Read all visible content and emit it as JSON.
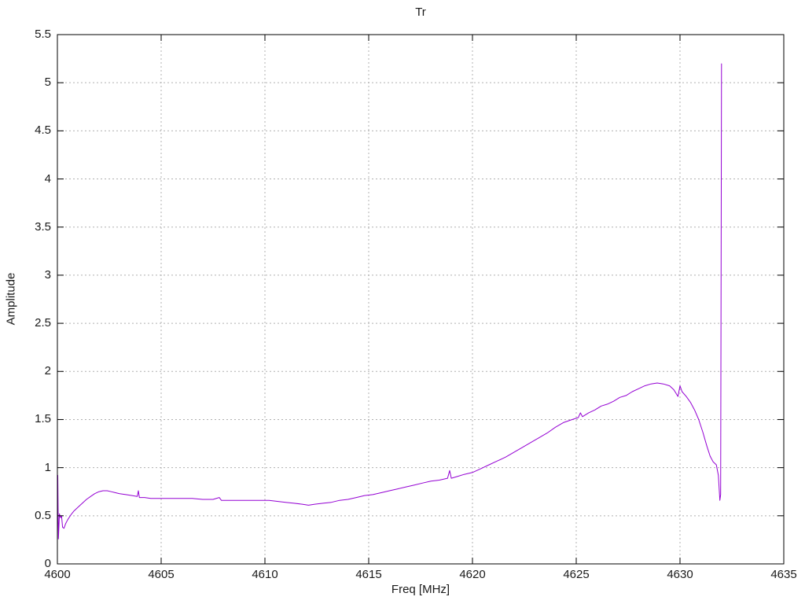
{
  "title": "Tr",
  "colors": {
    "line": "#9400d3",
    "grid": "#b0b0b0",
    "axis": "#000000",
    "text": "#1a1a1a",
    "background": "#ffffff"
  },
  "chart_data": {
    "type": "line",
    "title": "Tr",
    "xlabel": "Freq [MHz]",
    "ylabel": "Amplitude",
    "xlim": [
      4600,
      4635
    ],
    "ylim": [
      0,
      5.5
    ],
    "x_ticks": [
      4600,
      4605,
      4610,
      4615,
      4620,
      4625,
      4630,
      4635
    ],
    "y_ticks": [
      0,
      0.5,
      1,
      1.5,
      2,
      2.5,
      3,
      3.5,
      4,
      4.5,
      5,
      5.5
    ],
    "grid": true,
    "legend_position": "none",
    "series": [
      {
        "name": "Tr",
        "color": "#9400d3",
        "points": [
          [
            4600.0,
            0.3
          ],
          [
            4600.02,
            0.92
          ],
          [
            4600.05,
            0.26
          ],
          [
            4600.1,
            0.52
          ],
          [
            4600.15,
            0.48
          ],
          [
            4600.2,
            0.5
          ],
          [
            4600.25,
            0.38
          ],
          [
            4600.32,
            0.37
          ],
          [
            4600.4,
            0.42
          ],
          [
            4600.5,
            0.46
          ],
          [
            4600.65,
            0.51
          ],
          [
            4600.8,
            0.55
          ],
          [
            4601.0,
            0.59
          ],
          [
            4601.2,
            0.63
          ],
          [
            4601.4,
            0.67
          ],
          [
            4601.6,
            0.7
          ],
          [
            4601.8,
            0.73
          ],
          [
            4602.0,
            0.75
          ],
          [
            4602.2,
            0.76
          ],
          [
            4602.4,
            0.76
          ],
          [
            4602.6,
            0.75
          ],
          [
            4602.8,
            0.74
          ],
          [
            4603.0,
            0.73
          ],
          [
            4603.3,
            0.72
          ],
          [
            4603.6,
            0.71
          ],
          [
            4603.85,
            0.7
          ],
          [
            4603.9,
            0.76
          ],
          [
            4603.95,
            0.69
          ],
          [
            4604.2,
            0.69
          ],
          [
            4604.5,
            0.68
          ],
          [
            4605.0,
            0.68
          ],
          [
            4605.5,
            0.68
          ],
          [
            4606.0,
            0.68
          ],
          [
            4606.5,
            0.68
          ],
          [
            4607.0,
            0.67
          ],
          [
            4607.5,
            0.67
          ],
          [
            4607.8,
            0.69
          ],
          [
            4607.9,
            0.66
          ],
          [
            4608.2,
            0.66
          ],
          [
            4608.6,
            0.66
          ],
          [
            4609.0,
            0.66
          ],
          [
            4609.4,
            0.66
          ],
          [
            4609.8,
            0.66
          ],
          [
            4610.2,
            0.66
          ],
          [
            4610.6,
            0.65
          ],
          [
            4611.0,
            0.64
          ],
          [
            4611.4,
            0.63
          ],
          [
            4611.8,
            0.62
          ],
          [
            4612.1,
            0.61
          ],
          [
            4612.4,
            0.62
          ],
          [
            4612.8,
            0.63
          ],
          [
            4613.2,
            0.64
          ],
          [
            4613.6,
            0.66
          ],
          [
            4614.0,
            0.67
          ],
          [
            4614.4,
            0.69
          ],
          [
            4614.8,
            0.71
          ],
          [
            4615.2,
            0.72
          ],
          [
            4615.6,
            0.74
          ],
          [
            4616.0,
            0.76
          ],
          [
            4616.4,
            0.78
          ],
          [
            4616.8,
            0.8
          ],
          [
            4617.2,
            0.82
          ],
          [
            4617.6,
            0.84
          ],
          [
            4618.0,
            0.86
          ],
          [
            4618.4,
            0.87
          ],
          [
            4618.8,
            0.89
          ],
          [
            4618.9,
            0.97
          ],
          [
            4618.98,
            0.89
          ],
          [
            4619.3,
            0.91
          ],
          [
            4619.6,
            0.93
          ],
          [
            4620.0,
            0.95
          ],
          [
            4620.4,
            0.99
          ],
          [
            4620.8,
            1.03
          ],
          [
            4621.2,
            1.07
          ],
          [
            4621.6,
            1.11
          ],
          [
            4622.0,
            1.16
          ],
          [
            4622.4,
            1.21
          ],
          [
            4622.8,
            1.26
          ],
          [
            4623.2,
            1.31
          ],
          [
            4623.6,
            1.36
          ],
          [
            4624.0,
            1.42
          ],
          [
            4624.4,
            1.47
          ],
          [
            4624.8,
            1.5
          ],
          [
            4625.1,
            1.52
          ],
          [
            4625.2,
            1.57
          ],
          [
            4625.3,
            1.53
          ],
          [
            4625.6,
            1.57
          ],
          [
            4625.9,
            1.6
          ],
          [
            4626.2,
            1.64
          ],
          [
            4626.5,
            1.66
          ],
          [
            4626.8,
            1.69
          ],
          [
            4627.1,
            1.73
          ],
          [
            4627.4,
            1.75
          ],
          [
            4627.7,
            1.79
          ],
          [
            4628.0,
            1.82
          ],
          [
            4628.3,
            1.85
          ],
          [
            4628.6,
            1.87
          ],
          [
            4628.9,
            1.88
          ],
          [
            4629.2,
            1.87
          ],
          [
            4629.5,
            1.85
          ],
          [
            4629.7,
            1.81
          ],
          [
            4629.9,
            1.74
          ],
          [
            4630.0,
            1.85
          ],
          [
            4630.1,
            1.79
          ],
          [
            4630.3,
            1.74
          ],
          [
            4630.5,
            1.68
          ],
          [
            4630.7,
            1.6
          ],
          [
            4630.9,
            1.5
          ],
          [
            4631.1,
            1.37
          ],
          [
            4631.3,
            1.22
          ],
          [
            4631.45,
            1.12
          ],
          [
            4631.6,
            1.06
          ],
          [
            4631.75,
            1.03
          ],
          [
            4631.85,
            0.92
          ],
          [
            4631.92,
            0.66
          ],
          [
            4631.96,
            0.72
          ],
          [
            4632.0,
            5.2
          ]
        ]
      }
    ]
  }
}
